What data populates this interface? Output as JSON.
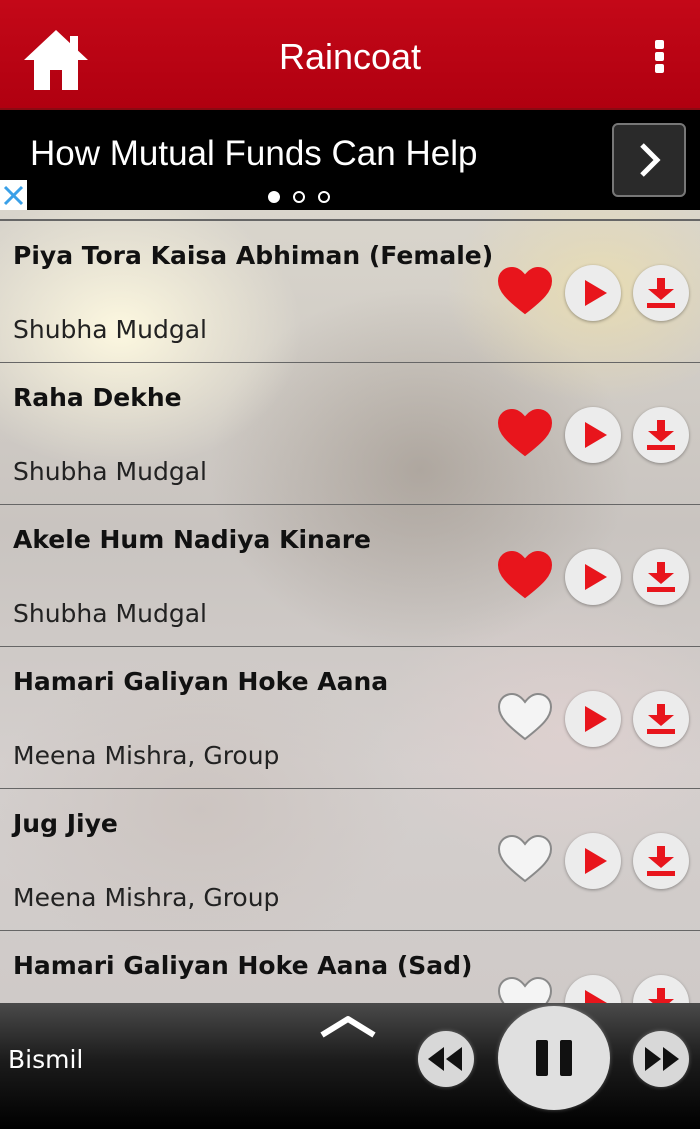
{
  "header": {
    "title": "Raincoat",
    "home_icon": "home-icon",
    "menu_icon": "overflow-menu-icon"
  },
  "ad": {
    "text": "How Mutual Funds Can Help",
    "next_icon": "chevron-right-icon",
    "close_icon": "close-icon",
    "page_count": 3,
    "active_page": 1
  },
  "songs": [
    {
      "title": "Piya Tora Kaisa Abhiman (Female)",
      "artist": "Shubha Mudgal",
      "favorite": true
    },
    {
      "title": "Raha Dekhe",
      "artist": "Shubha Mudgal",
      "favorite": true
    },
    {
      "title": "Akele Hum Nadiya Kinare",
      "artist": "Shubha Mudgal",
      "favorite": true
    },
    {
      "title": "Hamari Galiyan Hoke Aana",
      "artist": "Meena Mishra, Group",
      "favorite": false
    },
    {
      "title": "Jug Jiye",
      "artist": "Meena Mishra, Group",
      "favorite": false
    },
    {
      "title": "Hamari Galiyan Hoke Aana (Sad)",
      "artist": "",
      "favorite": false
    }
  ],
  "player": {
    "now_playing": "Bismil",
    "state": "playing"
  },
  "colors": {
    "header_red": "#c40818",
    "heart_red": "#e8151c",
    "play_red": "#e8151c"
  }
}
